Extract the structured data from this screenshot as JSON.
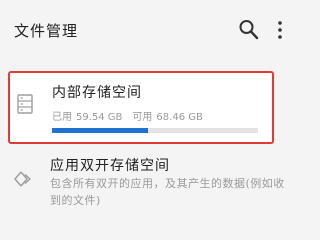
{
  "header": {
    "title": "文件管理",
    "search_icon": "search-icon",
    "menu_icon": "more-vertical-icon"
  },
  "internal_storage": {
    "label": "内部存储空间",
    "used_label": "已用",
    "used_value": "59.54 GB",
    "free_label": "可用",
    "free_value": "68.46 GB",
    "used_fraction": 0.465,
    "icon": "storage-icon",
    "bar_color": "#1e73d2",
    "highlight_color": "#e53935"
  },
  "dual_app_storage": {
    "label": "应用双开存储空间",
    "description": "包含所有双开的应用，及其产生的数据(例如收到的文件)",
    "icon": "dual-app-icon"
  }
}
